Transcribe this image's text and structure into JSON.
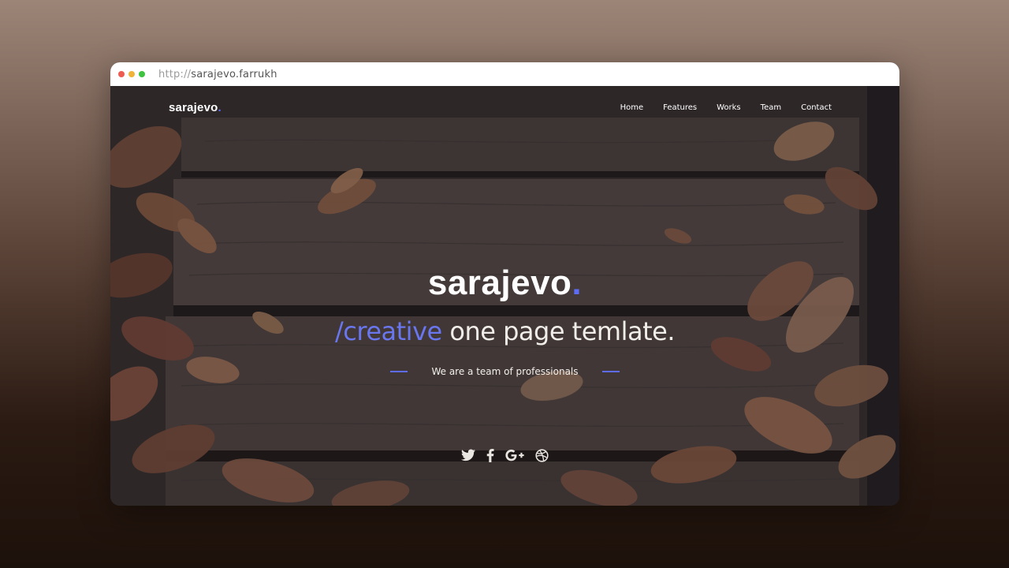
{
  "browser": {
    "url_protocol": "http://",
    "url_host": "sarajevo.farrukh"
  },
  "nav": {
    "logo_text": "sarajevo",
    "logo_dot": ".",
    "items": [
      "Home",
      "Features",
      "Works",
      "Team",
      "Contact"
    ]
  },
  "hero": {
    "title": "sarajevo",
    "title_dot": ".",
    "subtitle_prefix": "/creative",
    "subtitle_rest": " one page temlate.",
    "tagline": "We are a team of professionals"
  },
  "socials": [
    "twitter-icon",
    "facebook-icon",
    "google-plus-icon",
    "dribbble-icon"
  ],
  "colors": {
    "accent": "#5d6cf2",
    "text": "#ffffff"
  }
}
